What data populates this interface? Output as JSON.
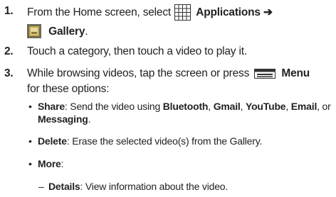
{
  "steps": [
    {
      "num": "1.",
      "line1_prefix": "From the Home screen, select",
      "applications": "Applications",
      "arrow": "➔",
      "gallery": "Gallery",
      "gallery_suffix": "."
    },
    {
      "num": "2.",
      "text": "Touch a category, then touch a video to play it."
    },
    {
      "num": "3.",
      "line1_prefix": "While browsing videos, tap the screen or press",
      "menu": "Menu",
      "line2": "for these options:"
    }
  ],
  "bullets": [
    {
      "dot": "•",
      "term": "Share",
      "text_prefix": ": Send the video using ",
      "opt1": "Bluetooth",
      "sep1": ", ",
      "opt2": "Gmail",
      "sep2": ", ",
      "opt3": "YouTube",
      "sep3": ", ",
      "opt4": "Email",
      "sep4": ", or",
      "opt5": "Messaging",
      "end": "."
    },
    {
      "dot": "•",
      "term": "Delete",
      "text": ": Erase the selected video(s) from the Gallery."
    },
    {
      "dot": "•",
      "term": "More",
      "text": ":"
    }
  ],
  "subitems": [
    {
      "dash": "–",
      "term": "Details",
      "text": ": View information about the video."
    }
  ],
  "icons": {
    "applications": "apps-grid-icon",
    "gallery": "gallery-icon",
    "menu": "menu-key-icon"
  },
  "colors": {
    "text": "#222222",
    "icon_dark": "#333333",
    "gallery_frame": "#6b6b58",
    "gallery_fill": "#c9a84a"
  }
}
